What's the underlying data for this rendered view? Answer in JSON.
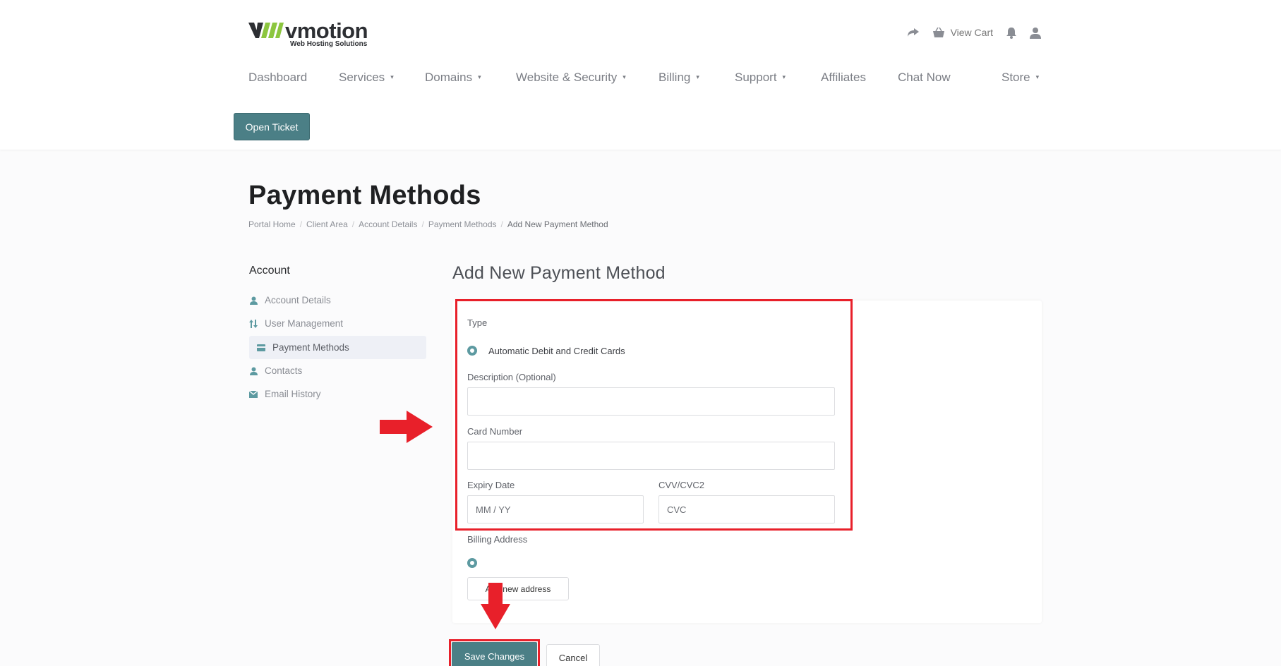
{
  "brand": {
    "name": "vmotion",
    "tagline": "Web Hosting Solutions"
  },
  "topbar": {
    "view_cart": "View Cart",
    "dropdown_caret": "▾"
  },
  "nav": [
    {
      "label": "Dashboard",
      "caret": ""
    },
    {
      "label": "Services",
      "caret": "▾"
    },
    {
      "label": "Domains",
      "caret": "▾"
    },
    {
      "label": "Website & Security",
      "caret": "▾"
    },
    {
      "label": "Billing",
      "caret": "▾"
    },
    {
      "label": "Support",
      "caret": "▾"
    },
    {
      "label": "Affiliates",
      "caret": ""
    },
    {
      "label": "Chat Now",
      "caret": ""
    },
    {
      "label": "Store",
      "caret": "▾"
    }
  ],
  "open_ticket": "Open Ticket",
  "page_title": "Payment Methods",
  "breadcrumb": [
    "Portal Home",
    "Client Area",
    "Account Details",
    "Payment Methods",
    "Add New Payment Method"
  ],
  "breadcrumb_sep": "/",
  "sidebar": {
    "title": "Account",
    "items": [
      {
        "label": "Account Details",
        "icon": "user-icon"
      },
      {
        "label": "User Management",
        "icon": "sort-arrows-icon"
      },
      {
        "label": "Payment Methods",
        "icon": "credit-card-icon"
      },
      {
        "label": "Contacts",
        "icon": "user-icon"
      },
      {
        "label": "Email History",
        "icon": "envelope-icon"
      }
    ]
  },
  "form": {
    "title": "Add New Payment Method",
    "type_label": "Type",
    "type_option": "Automatic Debit and Credit Cards",
    "description_label": "Description (Optional)",
    "description_value": "",
    "card_number_label": "Card Number",
    "card_number_value": "",
    "expiry_label": "Expiry Date",
    "expiry_placeholder": "MM / YY",
    "cvv_label": "CVV/CVC2",
    "cvv_placeholder": "CVC",
    "billing_label": "Billing Address",
    "add_address": "Add new address"
  },
  "actions": {
    "save": "Save Changes",
    "cancel": "Cancel"
  },
  "colors": {
    "accent": "#4b7f86",
    "highlight": "#e8202a",
    "brand_green": "#8cc63f"
  }
}
